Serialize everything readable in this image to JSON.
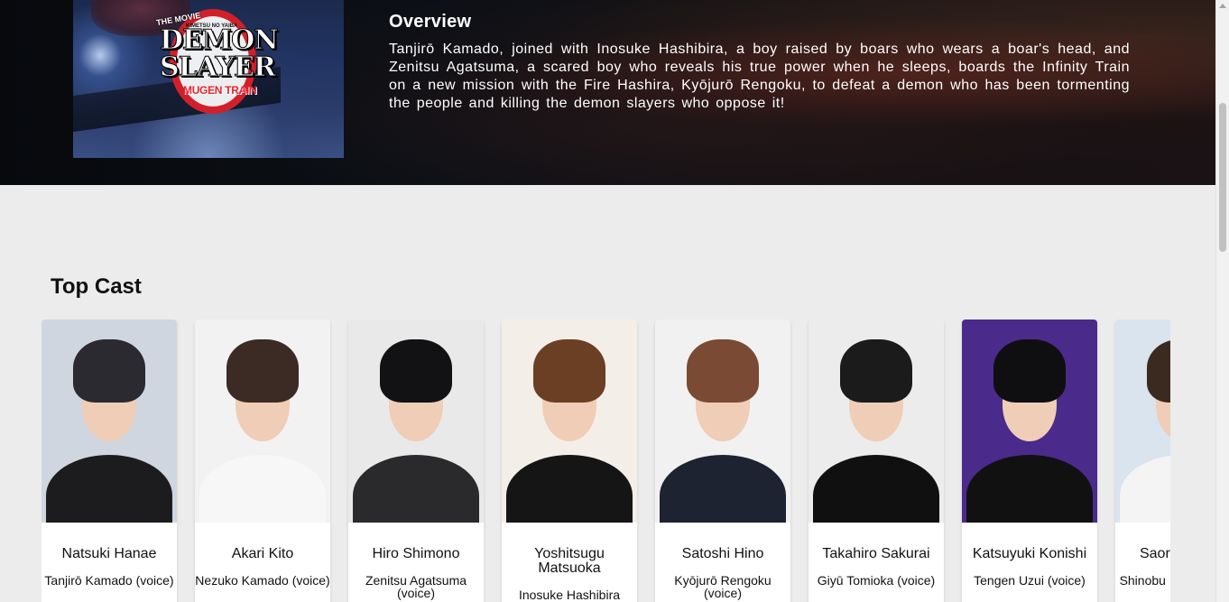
{
  "poster": {
    "small_top": "THE MOVIE",
    "series_small": "KIMETSU NO YAIBA",
    "title_line1": "DEMON",
    "title_line2": "SLAYER",
    "subtitle": "MUGEN TRAIN"
  },
  "overview": {
    "title": "Overview",
    "text": "Tanjirō Kamado, joined with Inosuke Hashibira, a boy raised by boars who wears a boar's head, and Zenitsu Agatsuma, a scared boy who reveals his true power when he sleeps, boards the Infinity Train on a new mission with the Fire Hashira, Kyōjurō Rengoku, to defeat a demon who has been tormenting the people and killing the demon slayers who oppose it!"
  },
  "cast": {
    "heading": "Top Cast",
    "members": [
      {
        "name": "Natsuki Hanae",
        "role": "Tanjirō Kamado (voice)",
        "bg": "#cfd6df",
        "hair": "#2a2a30",
        "body": "#1c1c1e"
      },
      {
        "name": "Akari Kito",
        "role": "Nezuko Kamado (voice)",
        "bg": "#f2f2f2",
        "hair": "#3b2b24",
        "body": "#f7f7f7"
      },
      {
        "name": "Hiro Shimono",
        "role": "Zenitsu Agatsuma (voice)",
        "bg": "#e9e9ea",
        "hair": "#121214",
        "body": "#2a2a2d"
      },
      {
        "name": "Yoshitsugu Matsuoka",
        "role": "Inosuke Hashibira",
        "bg": "#f4eee9",
        "hair": "#6b3f24",
        "body": "#151515"
      },
      {
        "name": "Satoshi Hino",
        "role": "Kyōjurō Rengoku (voice)",
        "bg": "#f1f1f1",
        "hair": "#7a4a34",
        "body": "#1d2330"
      },
      {
        "name": "Takahiro Sakurai",
        "role": "Giyū Tomioka (voice)",
        "bg": "#ececec",
        "hair": "#1b1b1b",
        "body": "#101010"
      },
      {
        "name": "Katsuyuki Konishi",
        "role": "Tengen Uzui (voice)",
        "bg": "#4a2a8a",
        "hair": "#0f0f12",
        "body": "#111111"
      },
      {
        "name": "Saori Hayami",
        "role": "Shinobu Kocho (voice)",
        "bg": "#d9e4ee",
        "hair": "#3a2a20",
        "body": "#f4f4f4"
      }
    ]
  }
}
